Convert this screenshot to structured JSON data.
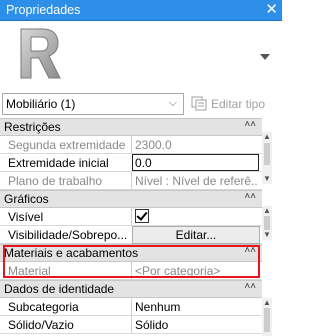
{
  "window": {
    "title": "Propriedades",
    "close_glyph": "✕"
  },
  "type_selector": {
    "icon": "revit-r-icon",
    "value": "Mobiliário (1)",
    "edit_type_label": "Editar tipo"
  },
  "categories": [
    {
      "label": "Restrições",
      "rows": [
        {
          "name": "Segunda extremidade",
          "value": "2300.0"
        },
        {
          "name": "Extremidade inicial",
          "value": "0.0"
        },
        {
          "name": "Plano de trabalho",
          "value": "Nível : Nível de referê..."
        }
      ]
    },
    {
      "label": "Gráficos",
      "rows": [
        {
          "name": "Visível",
          "value": ""
        },
        {
          "name": "Visibilidade/Sobrepo...",
          "value": "Editar..."
        }
      ]
    },
    {
      "label": "Materiais e acabamentos",
      "rows": [
        {
          "name": "Material",
          "value": "<Por categoria>"
        }
      ]
    },
    {
      "label": "Dados de identidade",
      "rows": [
        {
          "name": "Subcategoria",
          "value": "Nenhum"
        },
        {
          "name": "Sólido/Vazio",
          "value": "Sólido"
        }
      ]
    }
  ],
  "colors": {
    "titlebar": "#2e8fe8",
    "highlight": "#e8151d"
  }
}
